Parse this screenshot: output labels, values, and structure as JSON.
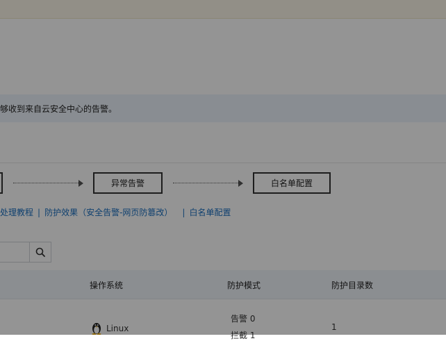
{
  "notice": {
    "text": "够收到来自云安全中心的告警。"
  },
  "flow": {
    "step_alert": "异常告警",
    "step_whitelist": "白名单配置"
  },
  "links": {
    "tutorial": "处理教程",
    "effect": "防护效果（安全告警-网页防篡改）",
    "whitelist": "白名单配置"
  },
  "search": {
    "value": "",
    "icon": "search-icon"
  },
  "table": {
    "columns": [
      "操作系统",
      "防护模式",
      "防护目录数"
    ],
    "row": {
      "os": "Linux",
      "os_icon": "linux-penguin-icon",
      "mode_alert": "告警 0",
      "mode_partial": "拦截 1",
      "dir_count": "1"
    }
  },
  "colors": {
    "link": "#1a6fc0",
    "header_bg": "#f0f4fa",
    "notice_bg": "#edf3fb"
  }
}
